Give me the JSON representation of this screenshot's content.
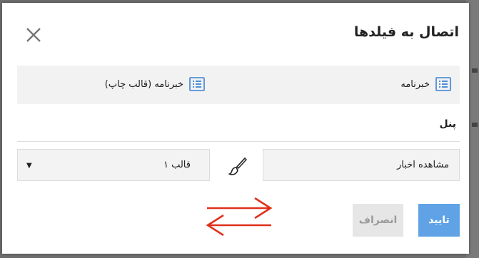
{
  "dialog": {
    "title": "اتصال به فیلدها",
    "info": {
      "right_label": "خبرنامه",
      "left_label": "خبرنامه (قالب چاپ)"
    },
    "panel_label": "پنل",
    "fields": {
      "news_value": "مشاهده اخبار",
      "template_value": "قالب ۱"
    },
    "buttons": {
      "confirm": "تایید",
      "cancel": "انصراف"
    }
  },
  "colors": {
    "accent": "#5fa3e6",
    "arrows": "#e0311b",
    "icon_blue": "#3b82d6"
  },
  "icons": [
    "close-icon",
    "list-icon",
    "brush-icon",
    "swap-arrows-icon",
    "dropdown-arrow-icon"
  ]
}
